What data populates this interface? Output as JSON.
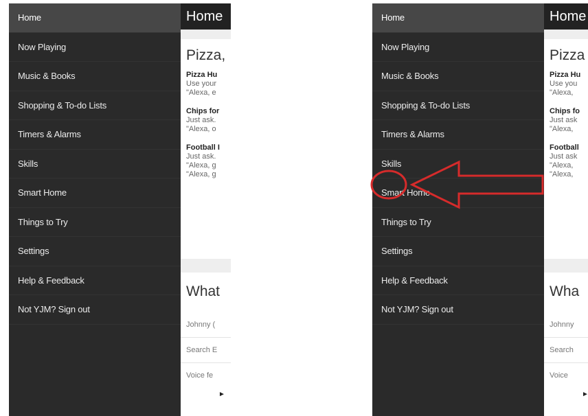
{
  "sidebar": {
    "items": [
      {
        "label": "Home"
      },
      {
        "label": "Now Playing"
      },
      {
        "label": "Music & Books"
      },
      {
        "label": "Shopping & To-do Lists"
      },
      {
        "label": "Timers & Alarms"
      },
      {
        "label": "Skills"
      },
      {
        "label": "Smart Home"
      },
      {
        "label": "Things to Try"
      },
      {
        "label": "Settings"
      },
      {
        "label": "Help & Feedback"
      },
      {
        "label": "Not YJM? Sign out"
      }
    ]
  },
  "left": {
    "header_title": "Home",
    "card1_title": "Pizza,",
    "blocks": [
      {
        "title": "Pizza Hu",
        "lines": [
          "Use your",
          "\"Alexa, e"
        ]
      },
      {
        "title": "Chips for",
        "lines": [
          "Just ask.",
          "\"Alexa, o"
        ]
      },
      {
        "title": "Football I",
        "lines": [
          "Just ask.",
          "\"Alexa, g",
          "\"Alexa, g"
        ]
      }
    ],
    "what_title": "What",
    "user_text": "Johnny (",
    "search_placeholder": "Search E",
    "voice_text": "Voice fe",
    "play_symbol": "►"
  },
  "right": {
    "header_title": "Home",
    "card1_title": "Pizza",
    "blocks": [
      {
        "title": "Pizza Hu",
        "lines": [
          "Use you",
          "\"Alexa, "
        ]
      },
      {
        "title": "Chips fo",
        "lines": [
          "Just ask",
          "\"Alexa, "
        ]
      },
      {
        "title": "Football",
        "lines": [
          "Just ask",
          "\"Alexa, ",
          "\"Alexa, "
        ]
      }
    ],
    "what_title": "Wha",
    "user_text": "Johnny",
    "search_placeholder": "Search",
    "voice_text": "Voice",
    "play_symbol": "►"
  },
  "annotation": {
    "color": "#d62b2b",
    "highlight_target": "Skills"
  }
}
